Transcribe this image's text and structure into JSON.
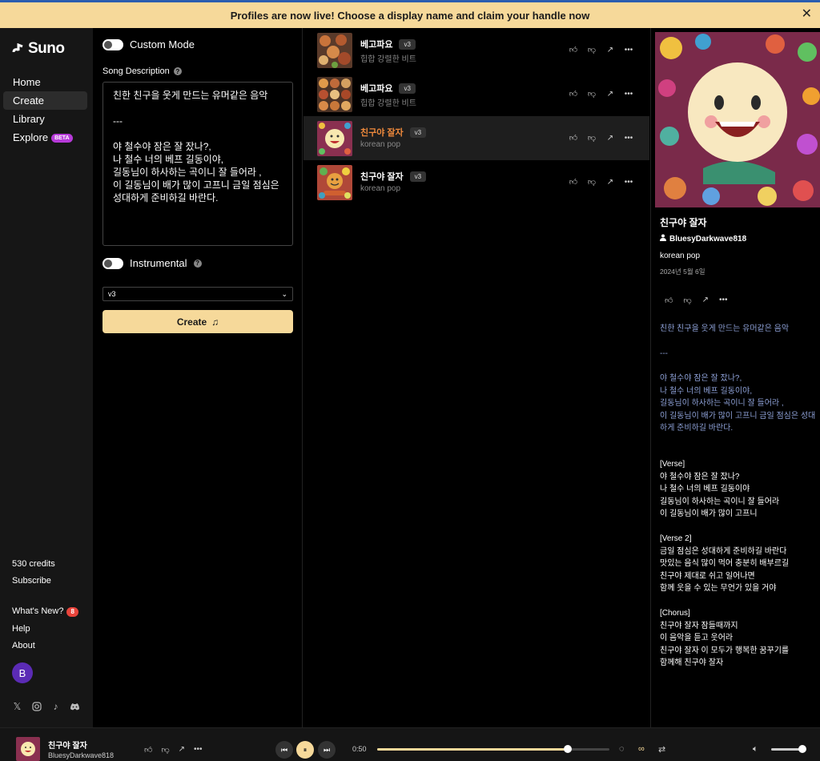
{
  "banner": {
    "text": "Profiles are now live! Choose a display name and claim your handle now",
    "close_icon": "close-icon"
  },
  "sidebar": {
    "logo_text": "Suno",
    "nav": [
      {
        "label": "Home",
        "active": false
      },
      {
        "label": "Create",
        "active": true
      },
      {
        "label": "Library",
        "active": false
      },
      {
        "label": "Explore",
        "active": false,
        "badge": "BETA"
      }
    ],
    "credits": "530 credits",
    "subscribe": "Subscribe",
    "whats_new": "What's New?",
    "whats_new_count": "8",
    "help": "Help",
    "about": "About",
    "avatar_initial": "B",
    "socials": [
      "x-icon",
      "instagram-icon",
      "tiktok-icon",
      "discord-icon"
    ]
  },
  "create": {
    "custom_mode_label": "Custom Mode",
    "song_description_label": "Song Description",
    "song_description": "친한 친구을 웃게 만드는 유머같은 음악\n\n---\n\n야 철수야 잠은 잘 잤나?,\n나 철수 너의 베프 길동이야,\n길동님이 하사하는 곡이니 잘 들어라 ,\n이 길동님이 배가 많이 고프니 금일 점심은 성대하게 준비하길 바란다.",
    "instrumental_label": "Instrumental",
    "model_version": "v3",
    "create_button": "Create"
  },
  "songs": [
    {
      "title": "베고파요",
      "tag": "v3",
      "subtitle": "힙합 강렬한 비트",
      "active": false,
      "highlight": false
    },
    {
      "title": "베고파요",
      "tag": "v3",
      "subtitle": "힙합 강렬한 비트",
      "active": false,
      "highlight": false
    },
    {
      "title": "친구야 잘자",
      "tag": "v3",
      "subtitle": "korean pop",
      "active": true,
      "highlight": true
    },
    {
      "title": "친구야 잘자",
      "tag": "v3",
      "subtitle": "korean pop",
      "active": false,
      "highlight": false
    }
  ],
  "details": {
    "title": "친구야 잘자",
    "user": "BluesyDarkwave818",
    "genre": "korean pop",
    "date": "2024년 5월 6일",
    "description": "친한 친구을 웃게 만드는 유머같은 음악\n\n---\n\n야 철수야 잠은 잘 잤나?,\n나 철수 너의 베프 길동이야,\n길동님이 하사하는 곡이니 잘 들어라 ,\n이 길동님이 배가 많이 고프니 금일 점심은 성대하게 준비하길 바란다.",
    "lyrics": "[Verse]\n야 철수야 잠은 잘 잤나?\n나 철수 너의 베프 길동이야\n길동님이 하사하는 곡이니 잘 들어라\n이 길동님이 배가 많이 고프니\n\n[Verse 2]\n금일 점심은 성대하게 준비하길 바란다\n맛있는 음식 많이 먹어 충분히 배부르길\n친구야 제대로 쉬고 일어나면\n함께 웃을 수 있는 무언가 있을 거야\n\n[Chorus]\n친구야 잘자 잠들때까지\n이 음악을 듣고 웃어라\n친구야 잘자 이 모두가 행복한 꿈꾸기를\n함께해 친구야 잘자"
  },
  "player": {
    "title": "친구야 잘자",
    "user": "BluesyDarkwave818",
    "time": "0:50",
    "progress": 0.82,
    "volume": 0.95,
    "loop_symbol": "∞"
  },
  "colors": {
    "accent": "#f6d99a",
    "highlight_title": "#f08a3c",
    "description_text": "#8da0d6"
  }
}
